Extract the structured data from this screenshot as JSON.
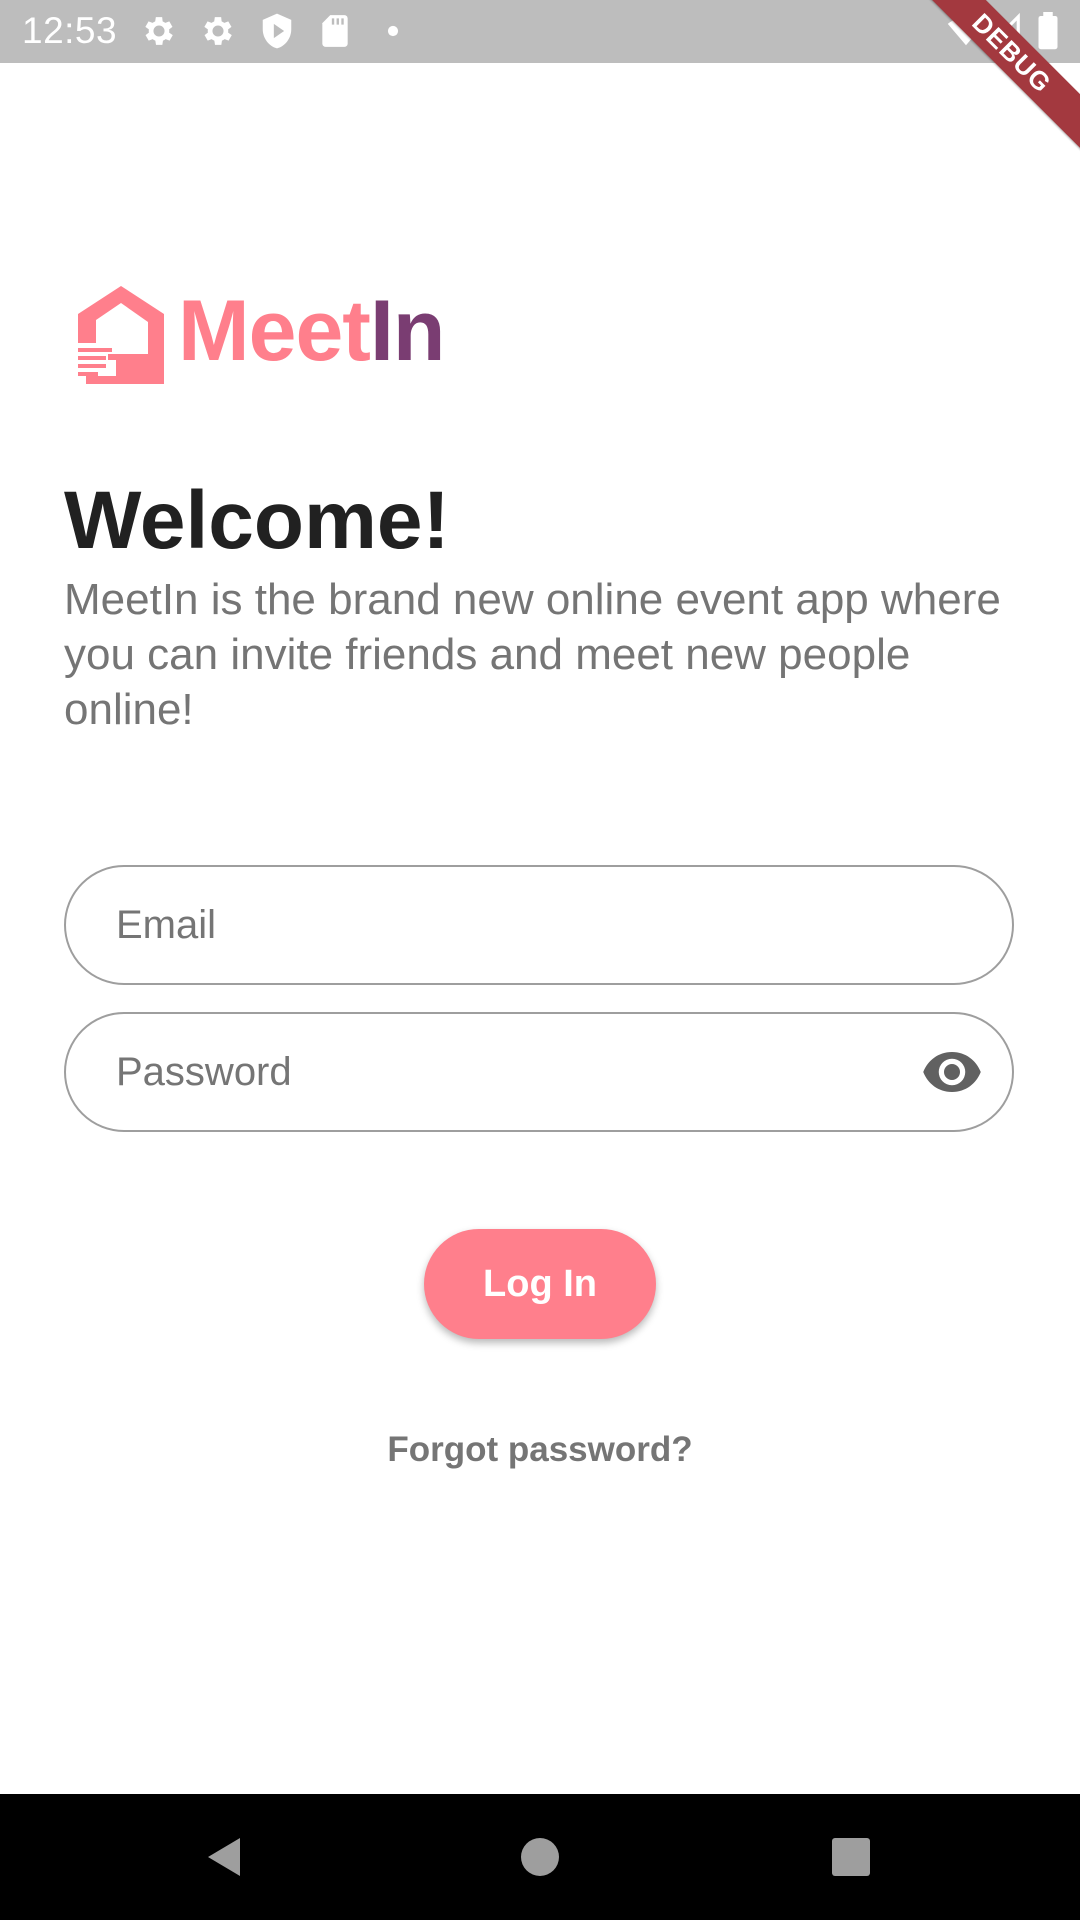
{
  "status_bar": {
    "time": "12:53",
    "icons": [
      "settings-icon",
      "settings-icon",
      "shield-play-icon",
      "sd-card-icon",
      "dot-icon",
      "wifi-icon",
      "signal-icon",
      "battery-icon"
    ],
    "debug_banner": "DEBUG"
  },
  "brand": {
    "name_part1": "Meet",
    "name_part2": "In",
    "color_primary": "#ff7f8c",
    "color_secondary": "#7a3d72"
  },
  "welcome": {
    "title": "Welcome!",
    "description": "MeetIn is the brand new online event app where you can invite friends and meet new people online!"
  },
  "form": {
    "email": {
      "placeholder": "Email",
      "value": ""
    },
    "password": {
      "placeholder": "Password",
      "value": "",
      "toggle_icon": "eye-icon"
    },
    "login_label": "Log In",
    "forgot_label": "Forgot password?"
  },
  "nav_bar": {
    "icons": [
      "back-icon",
      "home-icon",
      "recents-icon"
    ]
  }
}
